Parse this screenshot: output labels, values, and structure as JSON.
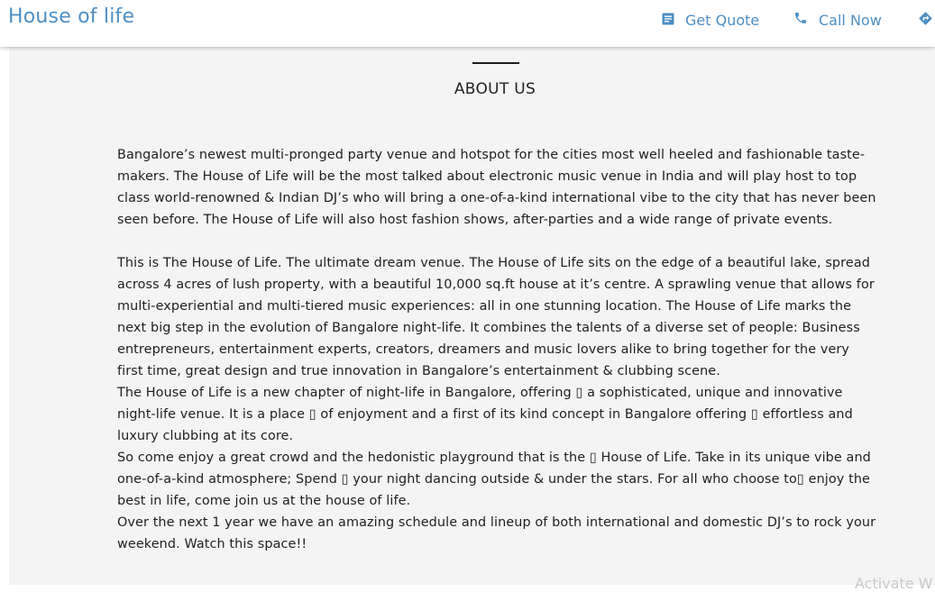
{
  "header": {
    "brand": "House of life",
    "actions": [
      {
        "label": "Get Quote",
        "icon": "document-icon"
      },
      {
        "label": "Call Now",
        "icon": "phone-icon"
      },
      {
        "label": "",
        "icon": "directions-icon"
      }
    ],
    "accent_color": "#4e8fc4"
  },
  "about": {
    "title": "ABOUT US",
    "paragraphs": [
      "Bangalore’s newest multi-pronged party venue and hotspot for the cities most well heeled and fashionable taste-makers. The House of Life will be the most talked about electronic music venue in India and will play host to top class world-renowned & Indian DJ’s who will bring a one-of-a-kind international vibe to the city that has never been seen before. The House of Life will also host fashion shows, after-parties and a wide range of private events.",
      "This is The House of Life. The ultimate dream venue. The House of Life sits on the edge of a beautiful lake, spread across 4 acres of lush property, with a beautiful 10,000 sq.ft house at it’s centre. A sprawling venue that allows for multi-experiential and multi-tiered music experiences: all in one stunning location. The House of Life marks the next big step in the evolution of Bangalore night-life. It combines the talents of a diverse set of people: Business entrepreneurs, entertainment experts, creators, dreamers and music lovers alike to bring together for the very first time, great design and true innovation in Bangalore’s entertainment & clubbing scene.",
      "The House of Life is a new chapter of night-life in Bangalore, offering ▯ a sophisticated, unique and innovative night-life venue. It is a place ▯ of enjoyment and a first of its kind concept in Bangalore offering ▯ effortless and luxury clubbing at its core.",
      "So come enjoy a great crowd and the hedonistic playground that is the ▯ House of Life. Take in its unique vibe and one-of-a-kind atmosphere; Spend ▯ your night dancing outside & under the stars. For all who choose to▯ enjoy the best in life, come join us at the house of life.",
      "Over the next 1 year we have an amazing schedule and lineup of both international and domestic DJ’s to rock your weekend. Watch this space!!"
    ]
  },
  "overlay": {
    "watermark": "Activate W"
  }
}
